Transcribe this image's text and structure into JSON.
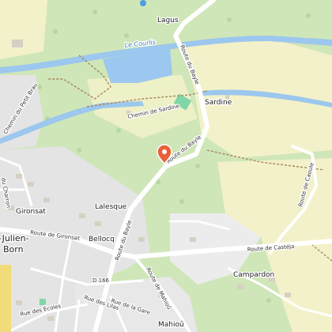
{
  "places": {
    "lagus": "Lagus",
    "sardine": "Sardine",
    "gironsat": "Gironsat",
    "lalesque": "Lalesque",
    "bellocq": "Bellocq",
    "campardon": "Campardon",
    "mahiou": "Mahioû",
    "town_partial": "-Julien-",
    "town_partial2": "Born"
  },
  "roads": {
    "route_du_bayle_north": "Route du Bayle",
    "route_du_bayle_mid": "Route du Bayle",
    "route_du_bayle_south": "Route du Bayle",
    "route_de_gironsat": "Route de Gironsat",
    "route_de_casteja": "Route de Castéja",
    "route_de_caoule": "Route de Caoule",
    "chemin_de_sardine": "Chemin de Sardine",
    "chemin_du_petit_brau": "Chemin du Petit Brau",
    "d166": "D 166",
    "route_de_mahiou": "Route de Mahioû",
    "rue_de_la_gare": "Rue de la Gare",
    "rue_des_lilas": "Rue des Lilas",
    "rue_des_ecoles": "Rue des Écoles",
    "charron_partial": "du Charron"
  },
  "water": {
    "river_name": "Le Courlis"
  },
  "marker": {
    "icon": "location-pin-icon",
    "color": "#e8613a"
  },
  "colors": {
    "forest": "#cfe6b8",
    "meadow": "#f3f1c9",
    "urban": "#e2e2e2",
    "water": "#9cc7ee",
    "road": "#ffffff",
    "path": "#a9855a"
  }
}
